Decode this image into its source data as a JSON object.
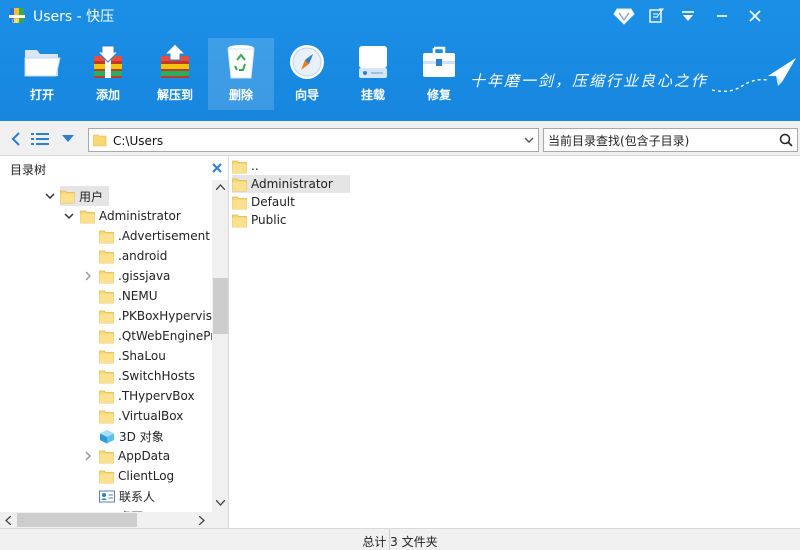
{
  "window": {
    "title": "Users - 快压",
    "icons": {
      "logo": "app-logo-icon",
      "skin": "diamond-skin-icon",
      "feedback": "edit-feedback-icon",
      "menu": "menu-dropdown-icon",
      "minimize": "minimize-icon",
      "close": "close-icon"
    }
  },
  "toolbar": {
    "items": [
      {
        "label": "打开",
        "icon": "open-folder-icon"
      },
      {
        "label": "添加",
        "icon": "add-archive-icon"
      },
      {
        "label": "解压到",
        "icon": "extract-archive-icon"
      },
      {
        "label": "删除",
        "icon": "recycle-bin-icon"
      },
      {
        "label": "向导",
        "icon": "compass-icon"
      },
      {
        "label": "挂载",
        "icon": "drive-mount-icon"
      },
      {
        "label": "修复",
        "icon": "toolbox-repair-icon"
      }
    ],
    "active_index": 3,
    "slogan": "十年磨一剑，压缩行业良心之作"
  },
  "navbar": {
    "path": "C:\\Users",
    "search_placeholder": "当前目录查找(包含子目录)"
  },
  "tree": {
    "title": "目录树",
    "rows": [
      {
        "label": "用户",
        "depth": 0,
        "arrow": "down",
        "icon": "folder",
        "selected": true
      },
      {
        "label": "Administrator",
        "depth": 1,
        "arrow": "down",
        "icon": "folder"
      },
      {
        "label": ".Advertisement",
        "depth": 2,
        "arrow": "",
        "icon": "folder"
      },
      {
        "label": ".android",
        "depth": 2,
        "arrow": "",
        "icon": "folder"
      },
      {
        "label": ".gissjava",
        "depth": 2,
        "arrow": "right",
        "icon": "folder"
      },
      {
        "label": ".NEMU",
        "depth": 2,
        "arrow": "",
        "icon": "folder"
      },
      {
        "label": ".PKBoxHypervisor",
        "depth": 2,
        "arrow": "",
        "icon": "folder"
      },
      {
        "label": ".QtWebEngineProcess",
        "depth": 2,
        "arrow": "",
        "icon": "folder"
      },
      {
        "label": ".ShaLou",
        "depth": 2,
        "arrow": "",
        "icon": "folder"
      },
      {
        "label": ".SwitchHosts",
        "depth": 2,
        "arrow": "",
        "icon": "folder"
      },
      {
        "label": ".THypervBox",
        "depth": 2,
        "arrow": "",
        "icon": "folder"
      },
      {
        "label": ".VirtualBox",
        "depth": 2,
        "arrow": "",
        "icon": "folder"
      },
      {
        "label": "3D 对象",
        "depth": 2,
        "arrow": "",
        "icon": "3d"
      },
      {
        "label": "AppData",
        "depth": 2,
        "arrow": "right",
        "icon": "folder"
      },
      {
        "label": "ClientLog",
        "depth": 2,
        "arrow": "",
        "icon": "folder"
      },
      {
        "label": "联系人",
        "depth": 2,
        "arrow": "",
        "icon": "contacts"
      },
      {
        "label": "桌面",
        "depth": 2,
        "arrow": "down",
        "icon": "desktop"
      }
    ]
  },
  "files": [
    {
      "name": ".."
    },
    {
      "name": "Administrator",
      "selected": true
    },
    {
      "name": "Default"
    },
    {
      "name": "Public"
    }
  ],
  "status": {
    "text": "总计 3 文件夹"
  },
  "colors": {
    "header": "#1b8fe6",
    "folder": "#f8d775",
    "selection": "#e5e5e5"
  }
}
